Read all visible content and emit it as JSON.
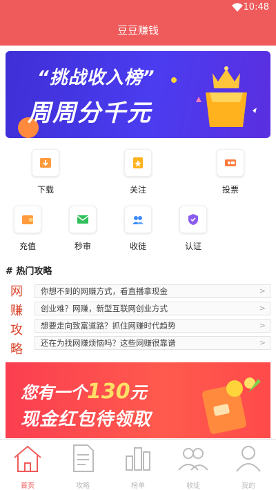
{
  "status_bar": {
    "time": "10:48"
  },
  "app_bar": {
    "title": "豆豆赚钱"
  },
  "banner": {
    "line1": "“挑战收入榜”",
    "line2": "周周分千元"
  },
  "grid_row1": [
    {
      "label": "下载",
      "icon": "download-icon"
    },
    {
      "label": "关注",
      "icon": "follow-icon"
    },
    {
      "label": "投票",
      "icon": "vote-icon"
    }
  ],
  "grid_row2": [
    {
      "label": "充值",
      "icon": "wallet-icon"
    },
    {
      "label": "秒审",
      "icon": "mail-icon"
    },
    {
      "label": "收徒",
      "icon": "apprentice-icon"
    },
    {
      "label": "认证",
      "icon": "shield-icon"
    }
  ],
  "hot": {
    "title": "# 热门攻略",
    "vertical": [
      "网",
      "赚",
      "攻",
      "略"
    ],
    "items": [
      "你想不到的网赚方式，看直播拿现金",
      "创业难？网赚，新型互联网创业方式",
      "想要走向致富道路？抓住网赚时代趋势",
      "还在为找网赚烦恼吗？这些网赚很靠谱"
    ]
  },
  "promo": {
    "line1_a": "您有一个",
    "line1_num": "130",
    "line1_b": "元",
    "line2": "现金红包待领取"
  },
  "tabs": [
    {
      "label": "首页",
      "active": true
    },
    {
      "label": "攻略",
      "active": false
    },
    {
      "label": "榜单",
      "active": false
    },
    {
      "label": "收徒",
      "active": false
    },
    {
      "label": "我的",
      "active": false
    }
  ],
  "colors": {
    "brand": "#ef5a5a",
    "banner": "#4b3cf0",
    "promo": "#fb3e50",
    "accent": "#d9432a"
  }
}
